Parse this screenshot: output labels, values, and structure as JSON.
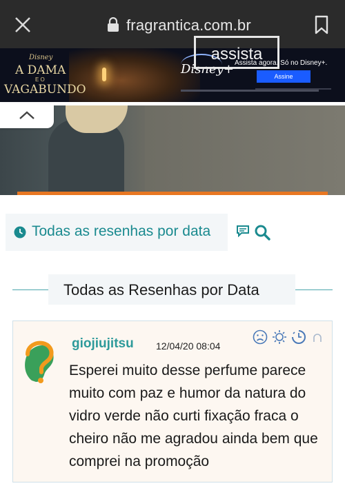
{
  "browser": {
    "url": "fragrantica.com.br",
    "icons": [
      "close-icon",
      "lock-icon",
      "bookmark-icon"
    ]
  },
  "ad": {
    "brand": "Disney",
    "title_line1": "A DAMA",
    "title_de": "E O",
    "title_line2": "VAGABUNDO",
    "logo_text": "Disney+",
    "tagline": "Assista agora. Só no Disney+.",
    "button_label": "Assine"
  },
  "hero": {
    "button_label": "assista",
    "accent_color": "#e87722"
  },
  "nav": {
    "label": "Todas as resenhas por data",
    "icons": [
      "clock-icon",
      "chat-icon",
      "search-icon"
    ],
    "color": "#1a8a8f"
  },
  "section": {
    "title": "Todas as Resenhas por Data"
  },
  "review": {
    "username": "giojiujitsu",
    "date": "12/04/20 08:04",
    "text": "Esperei muito desse perfume parece muito com paz e humor da natura do vidro verde não curti fixação fraca o cheiro não me agradou ainda bem que comprei na promoção",
    "rating_icons": [
      "sad-face-icon",
      "sun-icon",
      "clock-half-icon",
      "person-icon"
    ]
  }
}
